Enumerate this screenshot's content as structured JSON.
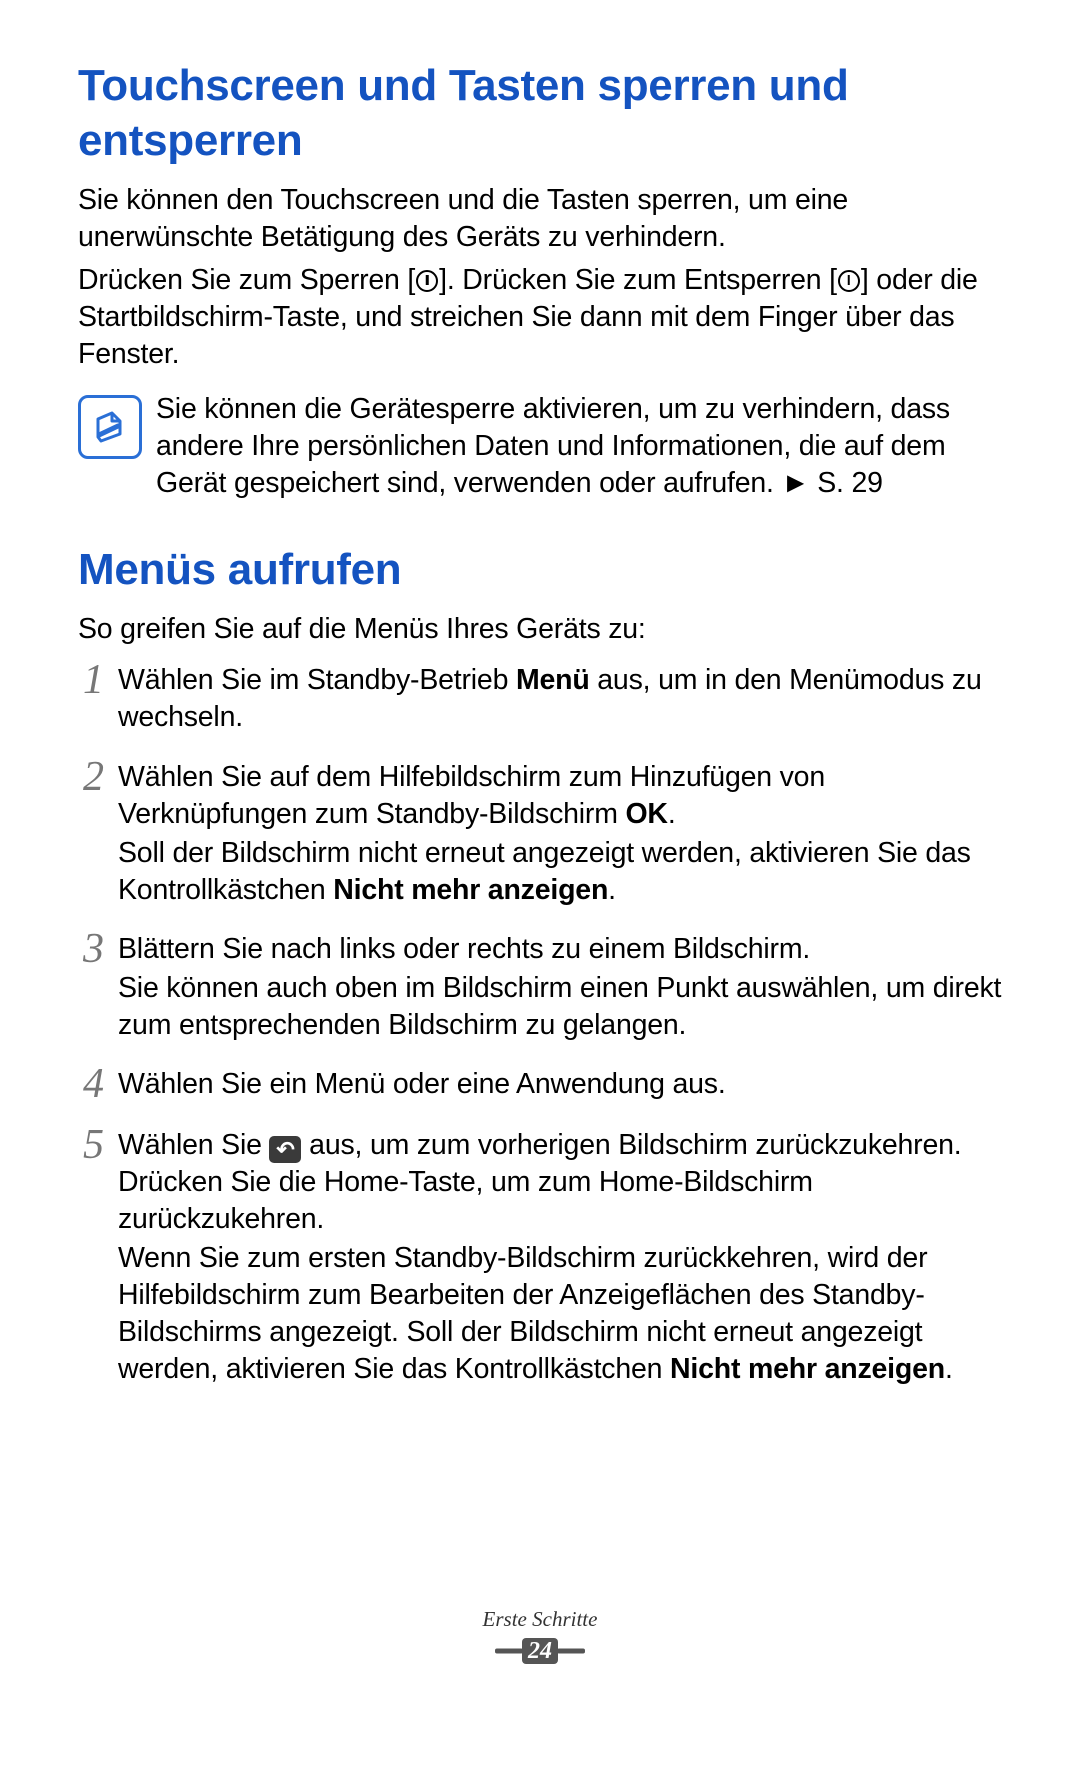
{
  "section1": {
    "title": "Touchscreen und Tasten sperren und entsperren",
    "para1": "Sie können den Touchscreen und die Tasten sperren, um eine unerwünschte Betätigung des Geräts zu verhindern.",
    "para2a": "Drücken Sie zum Sperren [",
    "para2b": "]. Drücken Sie zum Entsperren [",
    "para2c": "] oder die Startbildschirm-Taste, und streichen Sie dann mit dem Finger über das Fenster.",
    "note": "Sie können die Gerätesperre aktivieren, um zu verhindern, dass andere Ihre persönlichen Daten und Informationen, die auf dem Gerät gespeichert sind, verwenden oder aufrufen. ► S. 29"
  },
  "section2": {
    "title": "Menüs aufrufen",
    "intro": "So greifen Sie auf die Menüs Ihres Geräts zu:",
    "steps": {
      "n1": "1",
      "t1a": "Wählen Sie im Standby-Betrieb ",
      "t1b": "Menü",
      "t1c": " aus, um in den Menümodus zu wechseln.",
      "n2": "2",
      "t2a": "Wählen Sie auf dem Hilfebildschirm zum Hinzufügen von Verknüpfungen zum Standby-Bildschirm ",
      "t2b": "OK",
      "t2c": ".",
      "t2d": "Soll der Bildschirm nicht erneut angezeigt werden, aktivieren Sie das Kontrollkästchen ",
      "t2e": "Nicht mehr anzeigen",
      "t2f": ".",
      "n3": "3",
      "t3a": "Blättern Sie nach links oder rechts zu einem Bildschirm.",
      "t3b": "Sie können auch oben im Bildschirm einen Punkt auswählen, um direkt zum entsprechenden Bildschirm zu gelangen.",
      "n4": "4",
      "t4": "Wählen Sie ein Menü oder eine Anwendung aus.",
      "n5": "5",
      "t5a": "Wählen Sie ",
      "t5b": " aus, um zum vorherigen Bildschirm zurückzukehren. Drücken Sie die Home-Taste, um zum Home-Bildschirm zurückzukehren.",
      "t5c": "Wenn Sie zum ersten Standby-Bildschirm zurückkehren, wird der Hilfebildschirm zum Bearbeiten der Anzeigeflächen des Standby-Bildschirms angezeigt. Soll der Bildschirm nicht erneut angezeigt werden, aktivieren Sie das Kontrollkästchen ",
      "t5d": "Nicht mehr anzeigen",
      "t5e": "."
    }
  },
  "footer": {
    "section": "Erste Schritte",
    "page": "24"
  }
}
